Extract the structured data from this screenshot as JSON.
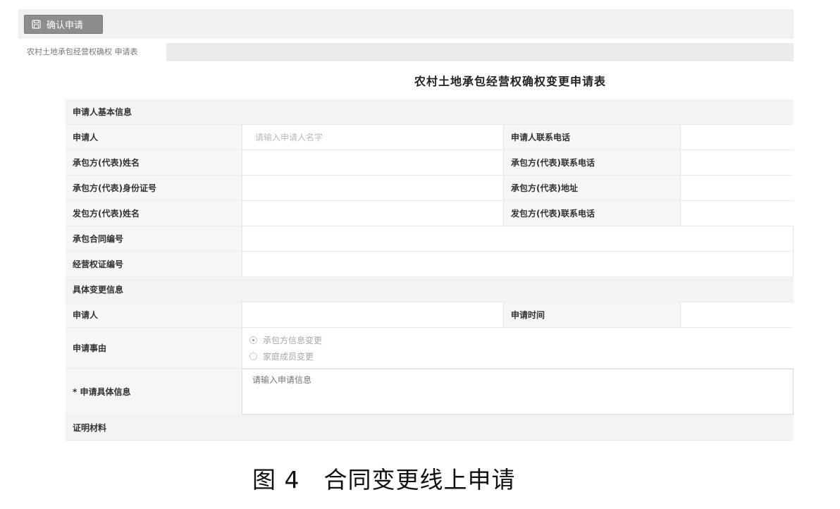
{
  "toolbar": {
    "confirm_label": "确认申请"
  },
  "tabs": [
    {
      "label": "农村土地承包经营权确权 申请表"
    }
  ],
  "form": {
    "title": "农村土地承包经营权确权变更申请表",
    "section_basic": "申请人基本信息",
    "applicant_label": "申请人",
    "applicant_placeholder": "请输入申请人名字",
    "applicant_phone_label": "申请人联系电话",
    "contractor_name_label": "承包方(代表)姓名",
    "contractor_phone_label": "承包方(代表)联系电话",
    "contractor_id_label": "承包方(代表)身份证号",
    "contractor_address_label": "承包方(代表)地址",
    "issuer_name_label": "发包方(代表)姓名",
    "issuer_phone_label": "发包方(代表)联系电话",
    "contract_no_label": "承包合同编号",
    "cert_no_label": "经营权证编号",
    "section_change": "具体变更信息",
    "applicant2_label": "申请人",
    "apply_time_label": "申请时间",
    "reason_label": "申请事由",
    "reason_options": [
      "承包方信息变更",
      "家庭成员变更"
    ],
    "reason_selected": "承包方信息变更",
    "detail_label": "* 申请具体信息",
    "detail_placeholder": "请输入申请信息",
    "proof_label": "证明材料"
  },
  "caption": {
    "text": "图 4　合同变更线上申请"
  },
  "icons": {
    "save": "save-icon"
  }
}
